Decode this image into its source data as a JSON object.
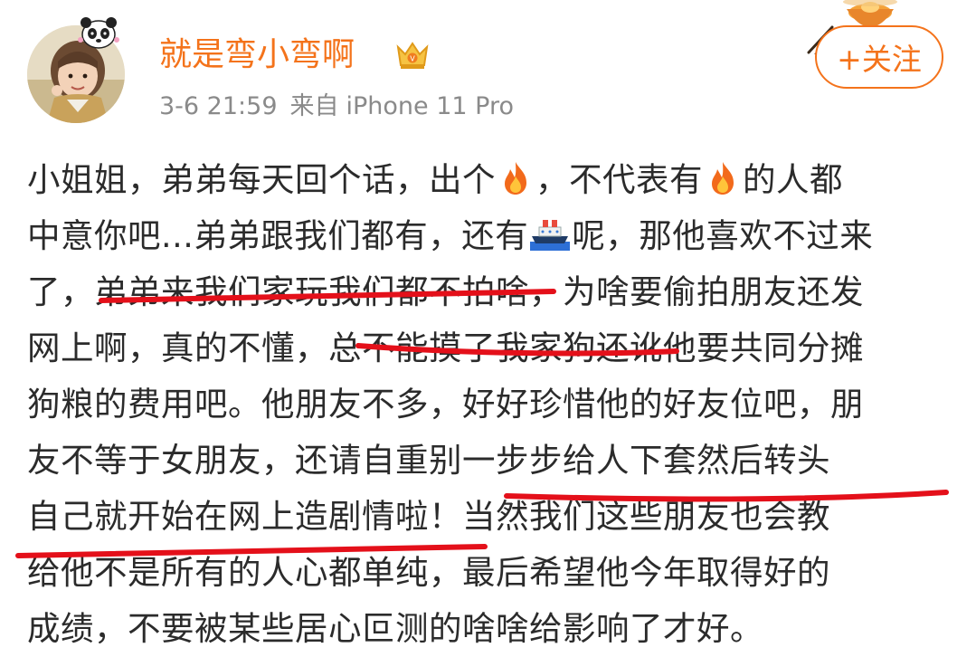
{
  "user": {
    "name": "就是弯小弯啊"
  },
  "meta": {
    "time": "3-6 21:59",
    "source_prefix": "来自",
    "device": "iPhone 11 Pro"
  },
  "follow_button": {
    "label": "+关注"
  },
  "post": {
    "lines": [
      {
        "a": "小姐姐，弟弟每天回个话，出个",
        "icon1": "fire-emoji",
        "b": "，不代表有",
        "icon2": "fire-emoji",
        "c": "的人都"
      },
      {
        "a": "中意你吧...弟弟跟我们都有，还有",
        "icon1": "ship-emoji",
        "b": "呢，那他喜欢不过来"
      },
      {
        "text": "了，弟弟来我们家玩我们都不拍啥，为啥要偷拍朋友还发"
      },
      {
        "text": "网上啊，真的不懂，总不能摸了我家狗还讹他要共同分摊"
      },
      {
        "text": "狗粮的费用吧。他朋友不多，好好珍惜他的好友位吧，朋"
      },
      {
        "text": "友不等于女朋友，还请自重别一步步给人下套然后转头"
      },
      {
        "text": "自己就开始在网上造剧情啦！当然我们这些朋友也会教"
      },
      {
        "text": "给他不是所有的人心都单纯，最后希望他今年取得好的"
      },
      {
        "text": "成绩，不要被某些居心叵测的啥啥给影响了才好。"
      }
    ]
  },
  "colors": {
    "username": "#f4731b",
    "follow_border": "#f4731b",
    "meta": "#8a8a8a",
    "body_text": "#2b2b2b",
    "scribble": "#e4101a"
  },
  "icons": {
    "avatar": "child-photo-avatar",
    "badge": "panda-icon",
    "verified": "crown-icon",
    "decoration": "bowl-icon"
  }
}
